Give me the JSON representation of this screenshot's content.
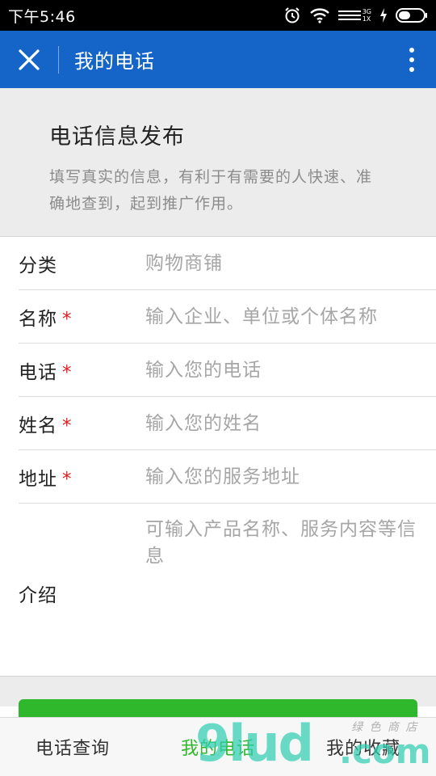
{
  "status_bar": {
    "time": "下午5:46",
    "network_small_top": "3G",
    "network_small_bottom": "1X",
    "icons": [
      "alarm-icon",
      "wifi-icon",
      "signal-icon",
      "charging-icon",
      "battery-icon"
    ]
  },
  "app_bar": {
    "title": "我的电话",
    "close_icon": "close-icon",
    "more_icon": "more-vertical-icon",
    "background": "#1565c8"
  },
  "intro": {
    "title": "电话信息发布",
    "description": "填写真实的信息，有利于有需要的人快速、准确地查到，起到推广作用。"
  },
  "form": {
    "required_mark": "*",
    "fields": [
      {
        "label": "分类",
        "placeholder": "购物商铺",
        "required": false
      },
      {
        "label": "名称",
        "placeholder": "输入企业、单位或个体名称",
        "required": true
      },
      {
        "label": "电话",
        "placeholder": "输入您的电话",
        "required": true
      },
      {
        "label": "姓名",
        "placeholder": "输入您的姓名",
        "required": true
      },
      {
        "label": "地址",
        "placeholder": "输入您的服务地址",
        "required": true
      }
    ],
    "intro_field": {
      "label": "介绍",
      "placeholder": "可输入产品名称、服务内容等信息"
    }
  },
  "tabs": [
    {
      "label": "电话查询",
      "active": false
    },
    {
      "label": "我的电话",
      "active": true
    },
    {
      "label": "我的收藏",
      "active": false
    }
  ],
  "watermark": {
    "main": "9lud",
    "suffix": ".com",
    "sub": "绿 色 商 店"
  },
  "colors": {
    "accent_green": "#2fb82c",
    "required_red": "#e02020",
    "brand_blue": "#1565c8"
  }
}
